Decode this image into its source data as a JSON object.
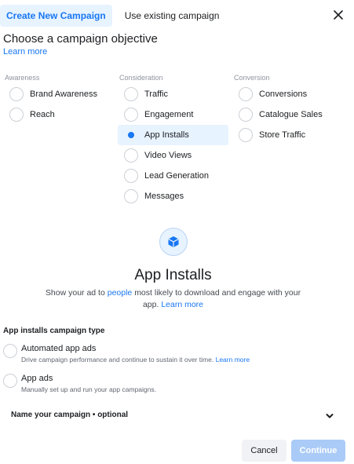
{
  "tabs": [
    {
      "label": "Create New Campaign"
    },
    {
      "label": "Use existing campaign"
    }
  ],
  "heading": "Choose a campaign objective",
  "learn_more": "Learn more",
  "columns": [
    {
      "title": "Awareness",
      "options": [
        "Brand Awareness",
        "Reach"
      ]
    },
    {
      "title": "Consideration",
      "options": [
        "Traffic",
        "Engagement",
        "App Installs",
        "Video Views",
        "Lead Generation",
        "Messages"
      ]
    },
    {
      "title": "Conversion",
      "options": [
        "Conversions",
        "Catalogue Sales",
        "Store Traffic"
      ]
    }
  ],
  "selected_objective": "App Installs",
  "objective": {
    "icon": "cube-icon",
    "title": "App Installs",
    "desc_before": "Show your ad to",
    "desc_link": "people",
    "desc_after": "most likely to download and engage with your app.",
    "learn_more": "Learn more"
  },
  "campaign_type": {
    "title": "App installs campaign type",
    "options": [
      {
        "label": "Automated app ads",
        "desc": "Drive campaign performance and continue to sustain it over time.",
        "link": "Learn more"
      },
      {
        "label": "App ads",
        "desc": "Manually set up and run your app campaigns."
      }
    ]
  },
  "name_campaign": "Name your campaign • optional",
  "buttons": {
    "cancel": "Cancel",
    "continue": "Continue"
  },
  "colors": {
    "accent": "#1877f2",
    "selected_bg": "#e7f3ff",
    "continue_disabled": "#aacbf7"
  }
}
